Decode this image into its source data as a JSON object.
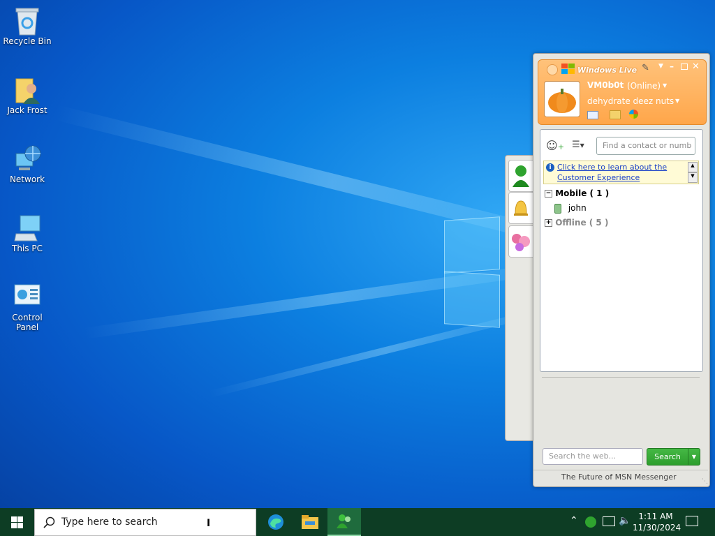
{
  "desktop": {
    "icons": [
      {
        "label": "Recycle Bin",
        "icon": "recycle-bin-icon"
      },
      {
        "label": "Jack Frost",
        "icon": "user-folder-icon"
      },
      {
        "label": "Network",
        "icon": "network-icon"
      },
      {
        "label": "This PC",
        "icon": "computer-icon"
      },
      {
        "label": "Control Panel",
        "icon": "control-panel-icon"
      }
    ]
  },
  "messenger": {
    "brand": "Windows Live",
    "username": "VM0b0t",
    "status": "(Online)",
    "personal_message": "dehydrate deez nuts",
    "search_contacts_placeholder": "Find a contact or number",
    "info_banner": "Click here to learn about the Customer Experience",
    "groups": [
      {
        "name": "Mobile ( 1 )",
        "expanded": true,
        "contacts": [
          "john"
        ]
      },
      {
        "name": "Offline ( 5 )",
        "expanded": false,
        "contacts": []
      }
    ],
    "web_search_placeholder": "Search the web...",
    "search_button": "Search",
    "footer": "The Future of MSN Messenger",
    "accent_color": "#ffa64a",
    "search_button_color": "#2e9e2e"
  },
  "taskbar": {
    "search_placeholder": "Type here to search",
    "time": "1:11 AM",
    "date": "11/30/2024",
    "color": "#0d3d24"
  }
}
